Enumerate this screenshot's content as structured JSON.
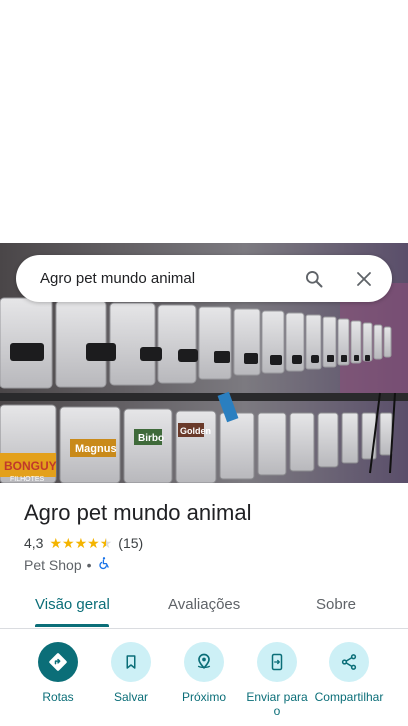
{
  "search": {
    "query": "Agro pet mundo animal"
  },
  "place": {
    "name": "Agro pet mundo animal",
    "rating": "4,3",
    "stars": 4.3,
    "review_count": "(15)",
    "category": "Pet Shop",
    "separator": "•"
  },
  "tabs": [
    {
      "label": "Visão geral",
      "active": true
    },
    {
      "label": "Avaliações",
      "active": false
    },
    {
      "label": "Sobre",
      "active": false
    }
  ],
  "actions": [
    {
      "label": "Rotas",
      "icon": "directions-icon"
    },
    {
      "label": "Salvar",
      "icon": "bookmark-icon"
    },
    {
      "label": "Próximo",
      "icon": "nearby-icon"
    },
    {
      "label": "Enviar para o",
      "icon": "send-to-phone-icon"
    },
    {
      "label": "Compartilhar",
      "icon": "share-icon"
    }
  ],
  "photo_text": [
    "BONGUY",
    "Magnus",
    "Birbo",
    "Golden",
    "FILHOTES"
  ],
  "colors": {
    "accent": "#0b6e78",
    "action_bg": "#cdf0f6",
    "star": "#f4b400"
  }
}
